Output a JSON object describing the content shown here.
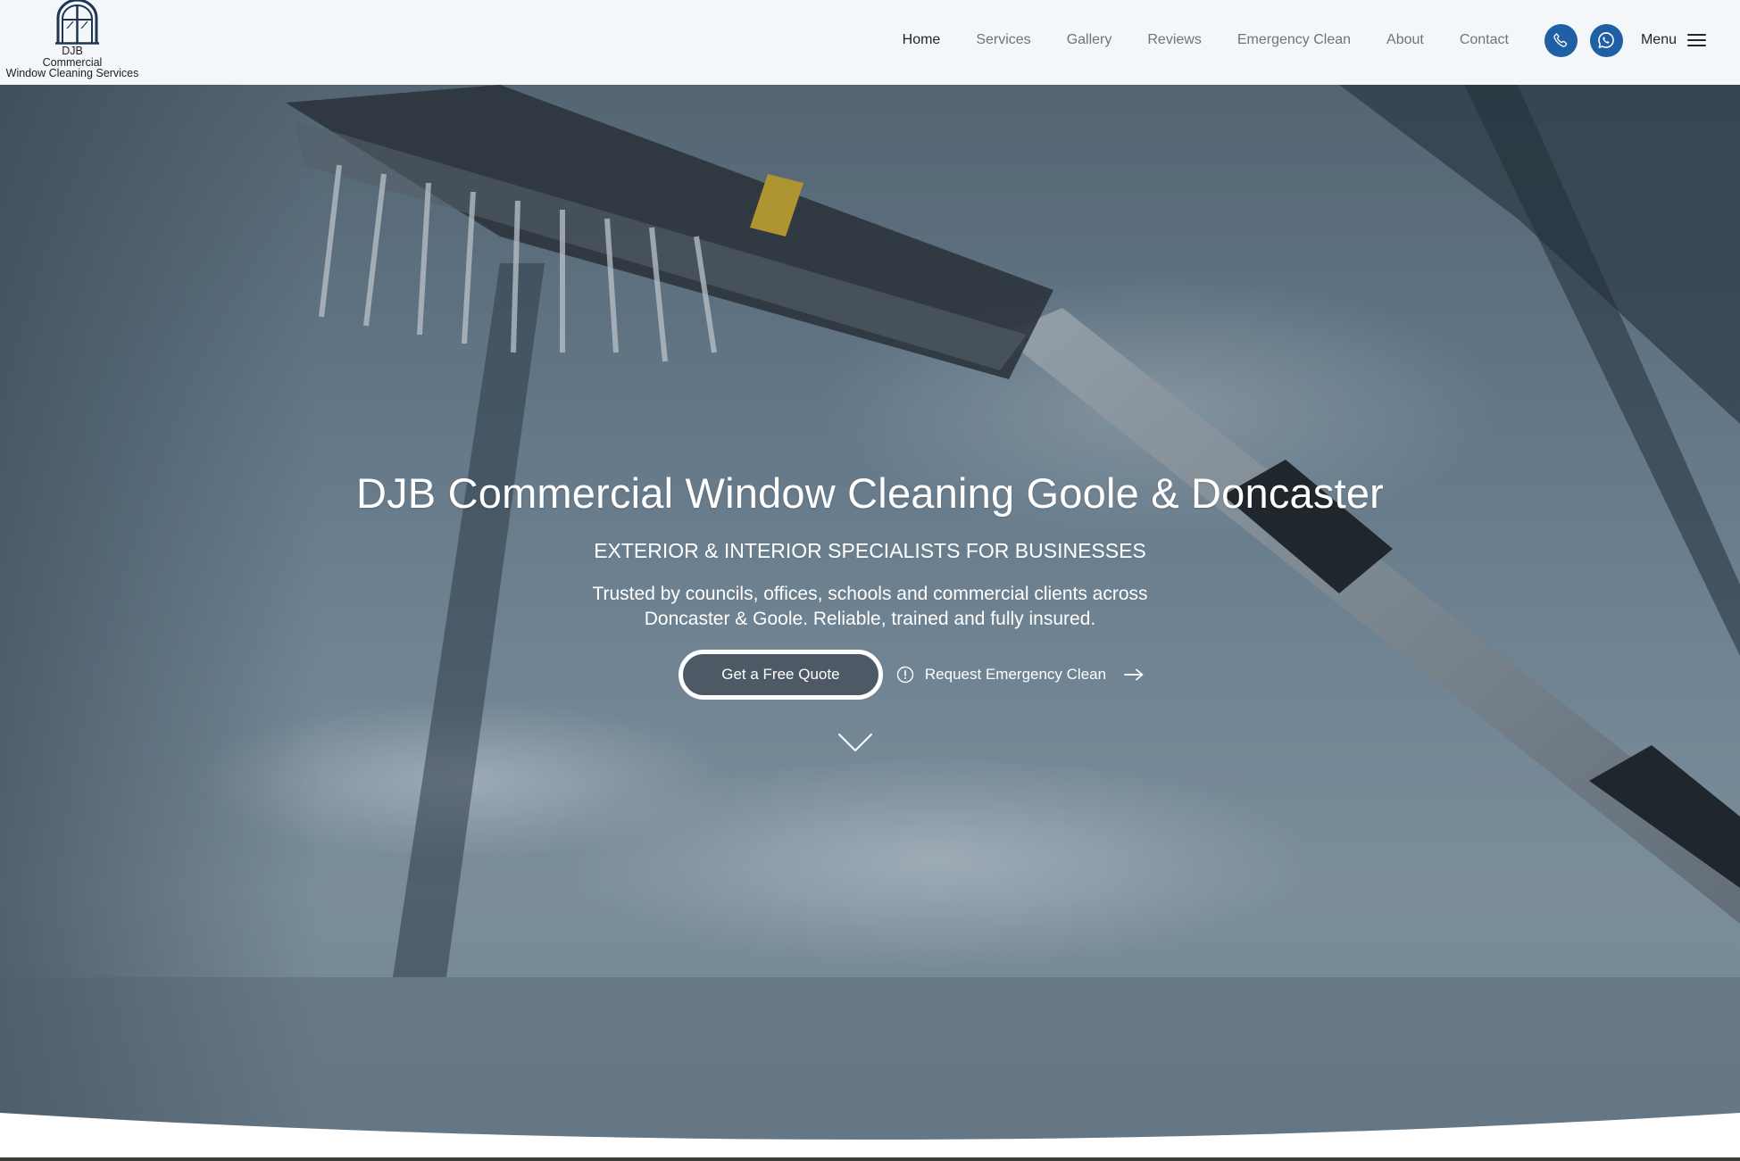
{
  "logo": {
    "icon": "arched-window-icon",
    "line1": "DJB",
    "line2": "Commercial",
    "line3": "Window Cleaning Services"
  },
  "nav": {
    "items": [
      {
        "label": "Home",
        "active": true
      },
      {
        "label": "Services",
        "active": false
      },
      {
        "label": "Gallery",
        "active": false
      },
      {
        "label": "Reviews",
        "active": false
      },
      {
        "label": "Emergency Clean",
        "active": false
      },
      {
        "label": "About",
        "active": false
      },
      {
        "label": "Contact",
        "active": false
      }
    ],
    "phone_icon": "phone-icon",
    "whatsapp_icon": "whatsapp-icon",
    "menu_label": "Menu",
    "menu_icon": "hamburger-icon"
  },
  "hero": {
    "title": "DJB Commercial Window Cleaning Goole & Doncaster",
    "subtitle": "EXTERIOR & INTERIOR SPECIALISTS FOR BUSINESSES",
    "desc_line1": "Trusted by councils, offices, schools and commercial clients across",
    "desc_line2": "Doncaster & Goole. Reliable, trained and fully insured.",
    "quote_button": "Get a Free Quote",
    "emergency_link": "Request Emergency Clean",
    "scroll_icon": "chevron-down-icon"
  },
  "colors": {
    "header_bg": "#f3f7fa",
    "accent_blue": "#1f5fa3",
    "nav_text": "#6f7478",
    "nav_active": "#222629"
  }
}
